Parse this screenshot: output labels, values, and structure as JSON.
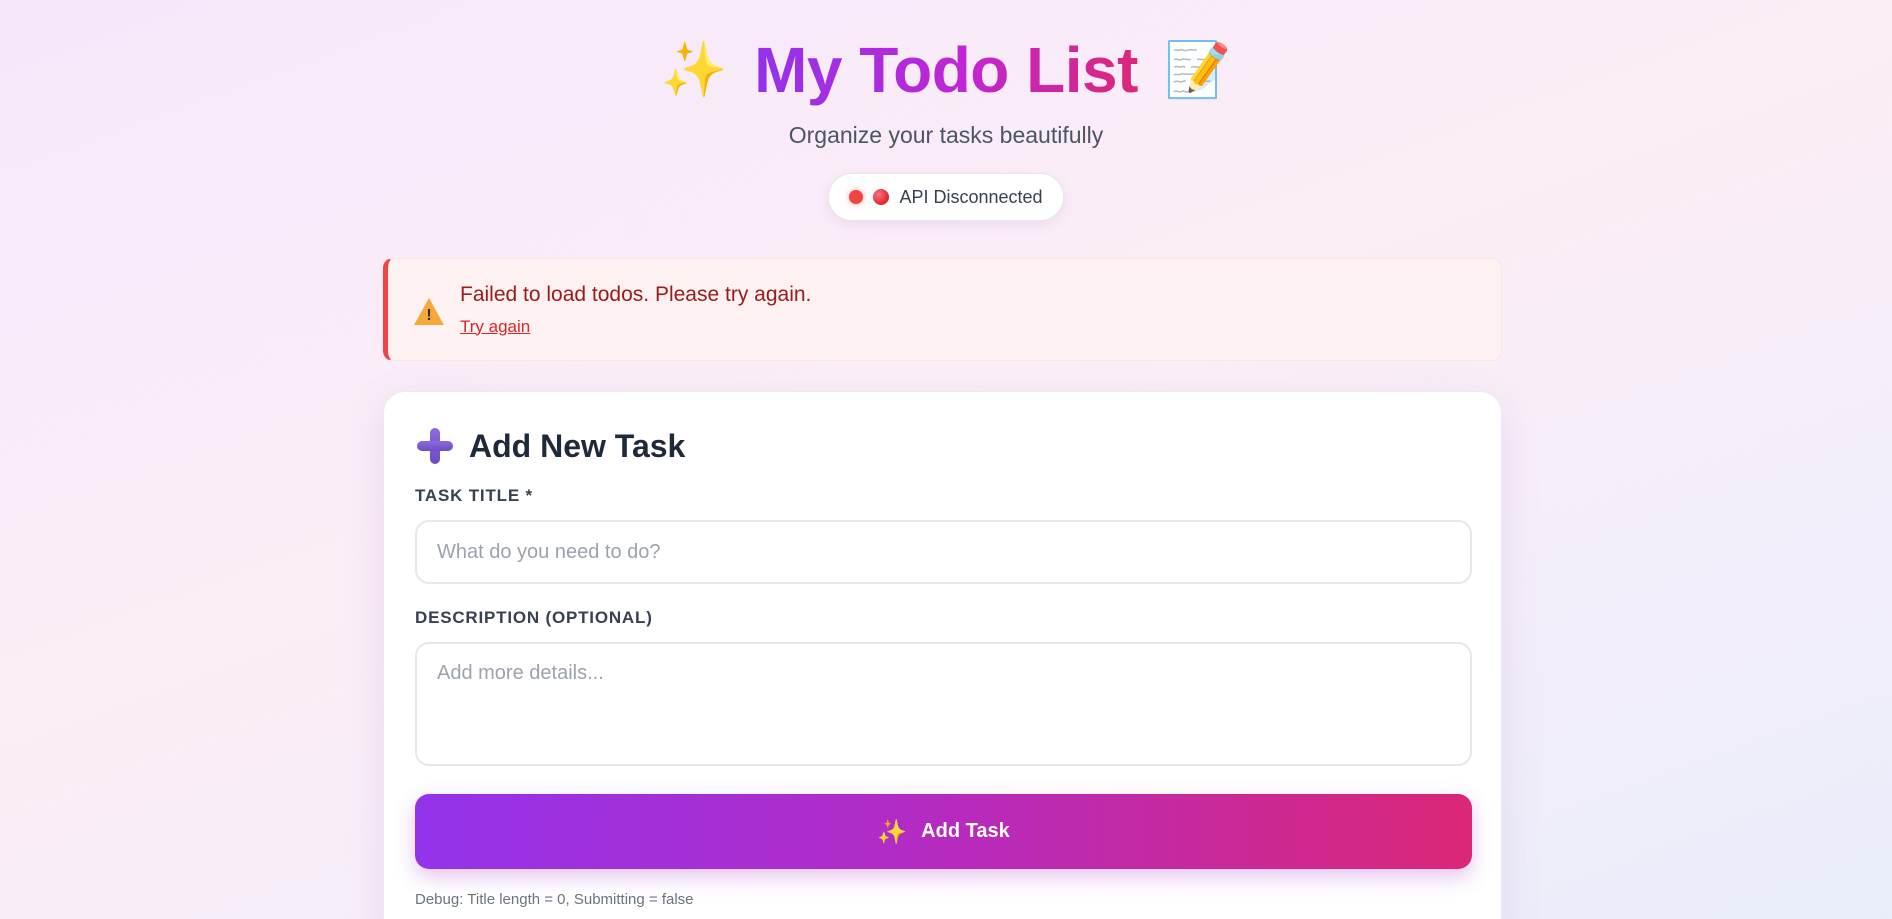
{
  "header": {
    "sparkle_emoji": "✨",
    "title": "My Todo List",
    "memo_emoji": "📝",
    "subtitle": "Organize your tasks beautifully"
  },
  "status": {
    "label": "🔴 API Disconnected",
    "text": "API Disconnected",
    "state": "disconnected",
    "color": "#ef4444"
  },
  "error": {
    "icon": "warning-icon",
    "message": "Failed to load todos. Please try again.",
    "retry_label": "Try again"
  },
  "form": {
    "heading_icon": "plus-icon",
    "heading": "Add New Task",
    "title_label": "TASK TITLE *",
    "title_value": "",
    "title_placeholder": "What do you need to do?",
    "description_label": "DESCRIPTION (OPTIONAL)",
    "description_value": "",
    "description_placeholder": "Add more details...",
    "submit_icon": "✨",
    "submit_label": "Add Task",
    "debug_text": "Debug: Title length = 0, Submitting = false"
  },
  "colors": {
    "accent_start": "#9333ea",
    "accent_end": "#db2777",
    "error": "#ef4444"
  }
}
